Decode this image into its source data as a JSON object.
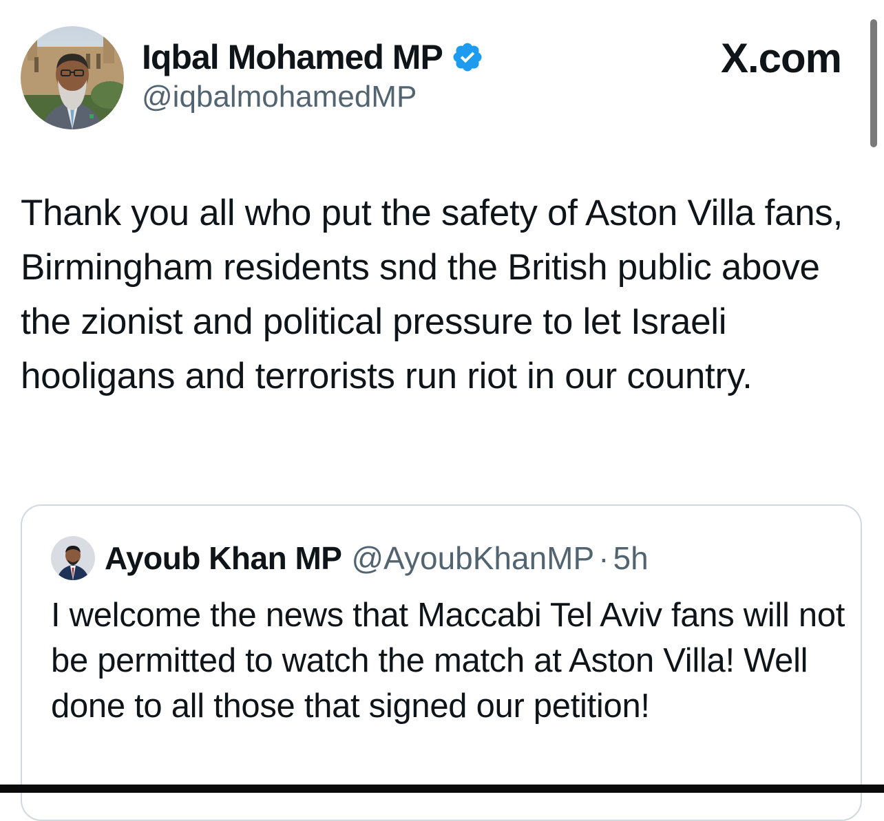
{
  "tweet": {
    "author_name": "Iqbal Mohamed MP",
    "author_handle": "@iqbalmohamedMP",
    "verified": true,
    "text": "Thank you all who put the safety of Aston Villa fans, Birmingham residents snd the British public above the zionist and political pressure to let Israeli hooligans and terrorists run riot in our country."
  },
  "site": {
    "brand": "X.com"
  },
  "quoted_tweet": {
    "author_name": "Ayoub Khan MP",
    "author_handle": "@AyoubKhanMP",
    "separator": "·",
    "time": "5h",
    "text": "I welcome the news that Maccabi Tel Aviv fans will not be permitted to watch the match at Aston Villa! Well done to all those that signed our petition!"
  },
  "colors": {
    "verified_blue": "#1d9bf0",
    "text_primary": "#0f1419",
    "text_secondary": "#536471",
    "card_border": "#cfd9de"
  },
  "icons": {
    "verified": "verified-badge-icon"
  }
}
